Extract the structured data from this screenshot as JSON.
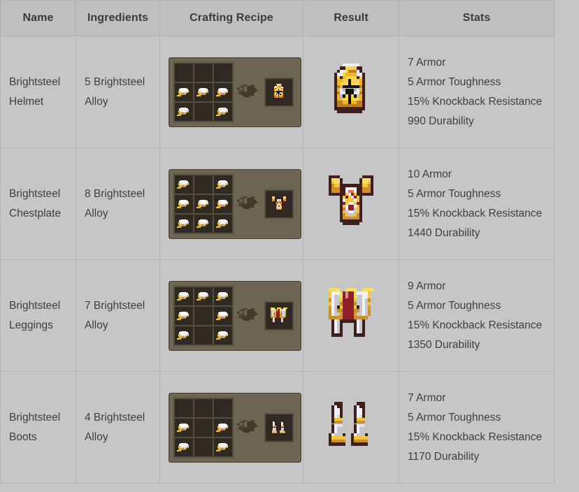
{
  "table": {
    "columns": [
      {
        "key": "name",
        "label": "Name"
      },
      {
        "key": "ing",
        "label": "Ingredients"
      },
      {
        "key": "craft",
        "label": "Crafting Recipe"
      },
      {
        "key": "result",
        "label": "Result"
      },
      {
        "key": "stats",
        "label": "Stats"
      }
    ],
    "rows": [
      {
        "name": "Brightsteel Helmet",
        "ingredients": "5 Brightsteel Alloy",
        "recipe": {
          "ingredient_icon": "brightsteel-alloy-ingot-icon",
          "result_icon": "brightsteel-helmet-icon",
          "arrow_icon": "crafting-arrow-icon",
          "grid": [
            [
              0,
              0,
              0
            ],
            [
              1,
              1,
              1
            ],
            [
              1,
              0,
              1
            ]
          ]
        },
        "result_icon": "brightsteel-helmet-icon",
        "stats": [
          "7 Armor",
          "5 Armor Toughness",
          "15% Knockback Resistance",
          "990 Durability"
        ]
      },
      {
        "name": "Brightsteel Chestplate",
        "ingredients": "8 Brightsteel Alloy",
        "recipe": {
          "ingredient_icon": "brightsteel-alloy-ingot-icon",
          "result_icon": "brightsteel-chestplate-icon",
          "arrow_icon": "crafting-arrow-icon",
          "grid": [
            [
              1,
              0,
              1
            ],
            [
              1,
              1,
              1
            ],
            [
              1,
              1,
              1
            ]
          ]
        },
        "result_icon": "brightsteel-chestplate-icon",
        "stats": [
          "10 Armor",
          "5 Armor Toughness",
          "15% Knockback Resistance",
          "1440 Durability"
        ]
      },
      {
        "name": "Brightsteel Leggings",
        "ingredients": "7 Brightsteel Alloy",
        "recipe": {
          "ingredient_icon": "brightsteel-alloy-ingot-icon",
          "result_icon": "brightsteel-leggings-icon",
          "arrow_icon": "crafting-arrow-icon",
          "grid": [
            [
              1,
              1,
              1
            ],
            [
              1,
              0,
              1
            ],
            [
              1,
              0,
              1
            ]
          ]
        },
        "result_icon": "brightsteel-leggings-icon",
        "stats": [
          "9 Armor",
          "5 Armor Toughness",
          "15% Knockback Resistance",
          "1350 Durability"
        ]
      },
      {
        "name": "Brightsteel Boots",
        "ingredients": "4 Brightsteel Alloy",
        "recipe": {
          "ingredient_icon": "brightsteel-alloy-ingot-icon",
          "result_icon": "brightsteel-boots-icon",
          "arrow_icon": "crafting-arrow-icon",
          "grid": [
            [
              0,
              0,
              0
            ],
            [
              1,
              0,
              1
            ],
            [
              1,
              0,
              1
            ]
          ]
        },
        "result_icon": "brightsteel-boots-icon",
        "stats": [
          "7 Armor",
          "5 Armor Toughness",
          "15% Knockback Resistance",
          "1170 Durability"
        ]
      }
    ]
  },
  "colors": {
    "page_bg": "#c6c6c6",
    "header_bg": "#bfbfbf",
    "cell_border": "#b4b4b4",
    "text": "#3f3f3f",
    "panel_bg": "#6d6452",
    "panel_border": "#564e3f",
    "slot_bg": "#2e2a22",
    "gold": "#f2c53d",
    "gold_dark": "#c8912a",
    "silver": "#e8e8ec",
    "dark_brown": "#3d1f1c",
    "crimson": "#8f1f28"
  }
}
